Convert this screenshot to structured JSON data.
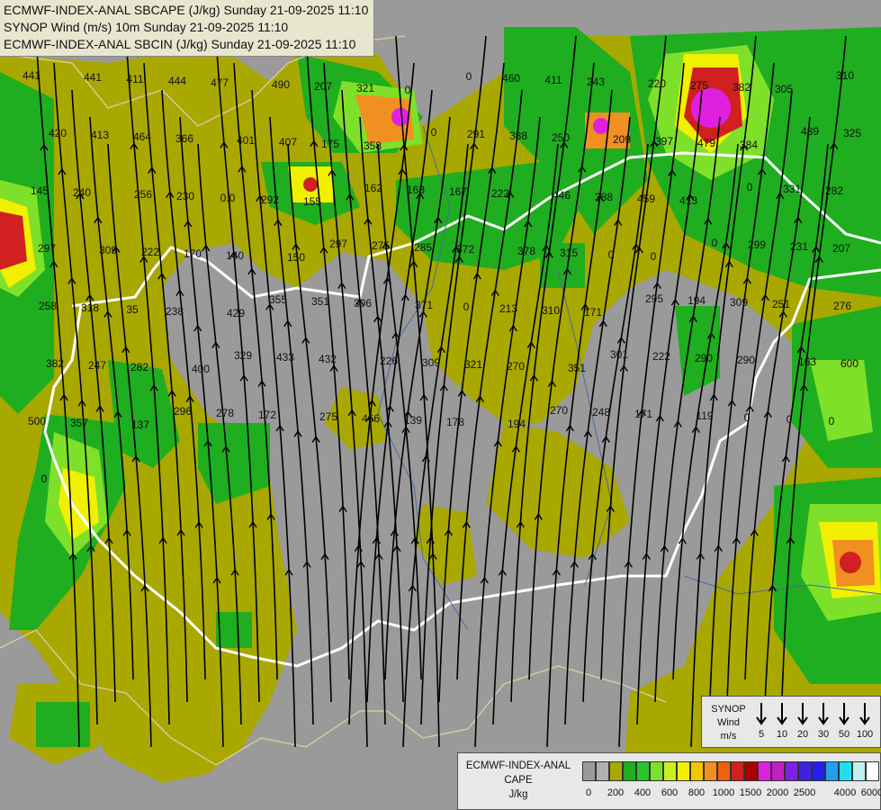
{
  "header": {
    "line1": "ECMWF-INDEX-ANAL SBCAPE (J/kg) Sunday 21-09-2025 11:10",
    "line2": "SYNOP Wind (m/s) 10m Sunday 21-09-2025 11:10",
    "line3": "ECMWF-INDEX-ANAL SBCIN (J/kg) Sunday 21-09-2025 11:10"
  },
  "colors": {
    "background": "#9a9a9a",
    "olive": "#a8a800",
    "green_dark": "#1fae1f",
    "green": "#2cc42c",
    "green_light": "#7fe02a",
    "yellow": "#f0f000",
    "orange": "#f09020",
    "red": "#d02020",
    "magenta": "#e020e0",
    "border_white": "#ffffff",
    "border_tan": "#d8c8a0",
    "streamline": "#000000"
  },
  "station_values": [
    "441",
    "441",
    "411",
    "444",
    "477",
    "490",
    "207",
    "321",
    "0",
    "0",
    "460",
    "411",
    "243",
    "220",
    "275",
    "382",
    "305",
    "310",
    "420",
    "413",
    "464",
    "366",
    "401",
    "407",
    "175",
    "358",
    "0",
    "291",
    "388",
    "250",
    "209",
    "397",
    "479",
    "384",
    "489",
    "325",
    "145",
    "240",
    "256",
    "230",
    "0.0",
    "292",
    "155",
    "162",
    "163",
    "167",
    "222",
    "446",
    "388",
    "459",
    "413",
    "0",
    "331",
    "282",
    "297",
    "309",
    "222",
    "170",
    "140",
    "150",
    "297",
    "275",
    "285",
    "372",
    "378",
    "315",
    "0",
    "0",
    "0",
    "299",
    "231",
    "207",
    "258",
    "318",
    "35",
    "238",
    "429",
    "355",
    "351",
    "306",
    "371",
    "0",
    "213",
    "310",
    "171",
    "295",
    "194",
    "309",
    "251",
    "276",
    "382",
    "247",
    "282",
    "400",
    "329",
    "433",
    "432",
    "226",
    "309",
    "321",
    "270",
    "351",
    "301",
    "222",
    "290",
    "290",
    "163",
    "600",
    "500",
    "357",
    "137",
    "296",
    "278",
    "172",
    "275",
    "466",
    "139",
    "178",
    "194",
    "270",
    "248",
    "171",
    "119",
    "0",
    "0",
    "0",
    "0"
  ],
  "legend_synop": {
    "title_lines": [
      "SYNOP",
      "Wind",
      "m/s"
    ],
    "speeds": [
      "5",
      "10",
      "20",
      "30",
      "50",
      "100"
    ]
  },
  "legend_cape": {
    "title_lines": [
      "ECMWF-INDEX-ANAL",
      "CAPE",
      "J/kg"
    ],
    "colors": [
      "#9a9a9a",
      "#b0b0b0",
      "#a8a800",
      "#1fae1f",
      "#2cc42c",
      "#7fe02a",
      "#c8f020",
      "#f0f000",
      "#f0c800",
      "#f09020",
      "#f06010",
      "#d02020",
      "#a80000",
      "#e020e0",
      "#c020c0",
      "#8020e0",
      "#4020e0",
      "#2020f0",
      "#20a0f0",
      "#20e0f0",
      "#c0f0f0",
      "#ffffff"
    ],
    "ticks": [
      "0",
      "200",
      "400",
      "600",
      "800",
      "1000",
      "1500",
      "2000",
      "2500",
      "4000",
      "6000"
    ]
  }
}
